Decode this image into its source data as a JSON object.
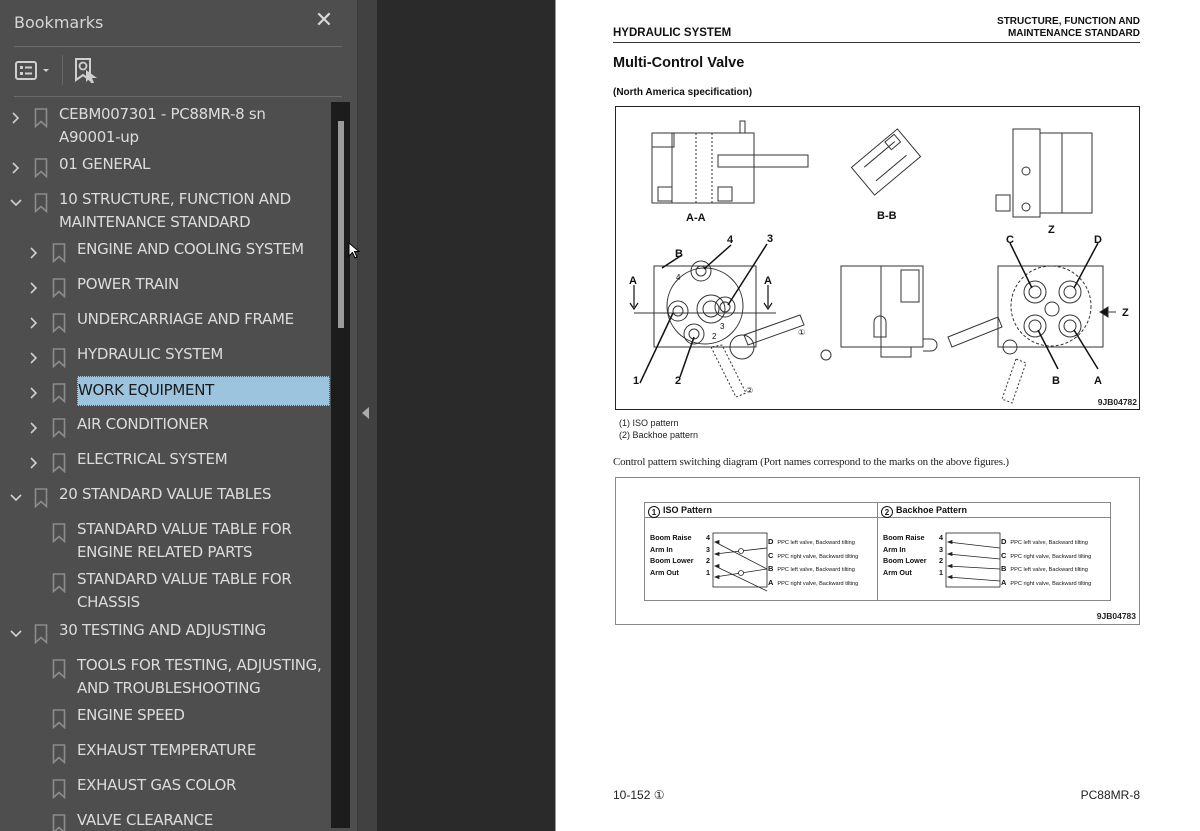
{
  "sidebar": {
    "title": "Bookmarks",
    "close_icon": "close-icon",
    "toolbar": {
      "options_icon": "list-options-icon",
      "find_icon": "find-current-bookmark-icon"
    },
    "items": [
      {
        "label": "CEBM007301 - PC88MR-8 sn\nA90001-up",
        "level": 0,
        "expander": "collapsed"
      },
      {
        "label": "01 GENERAL",
        "level": 0,
        "expander": "collapsed"
      },
      {
        "label": "10 STRUCTURE, FUNCTION AND\nMAINTENANCE STANDARD",
        "level": 0,
        "expander": "expanded"
      },
      {
        "label": "ENGINE AND COOLING SYSTEM",
        "level": 1,
        "expander": "collapsed"
      },
      {
        "label": "POWER TRAIN",
        "level": 1,
        "expander": "collapsed"
      },
      {
        "label": "UNDERCARRIAGE AND FRAME",
        "level": 1,
        "expander": "collapsed"
      },
      {
        "label": "HYDRAULIC SYSTEM",
        "level": 1,
        "expander": "collapsed"
      },
      {
        "label": "WORK EQUIPMENT",
        "level": 1,
        "expander": "collapsed",
        "selected": true
      },
      {
        "label": "AIR CONDITIONER",
        "level": 1,
        "expander": "collapsed"
      },
      {
        "label": "ELECTRICAL SYSTEM",
        "level": 1,
        "expander": "collapsed"
      },
      {
        "label": "20 STANDARD VALUE TABLES",
        "level": 0,
        "expander": "expanded"
      },
      {
        "label": "STANDARD VALUE TABLE FOR\nENGINE RELATED PARTS",
        "level": 1,
        "expander": "none"
      },
      {
        "label": "STANDARD VALUE TABLE FOR\nCHASSIS",
        "level": 1,
        "expander": "none"
      },
      {
        "label": "30 TESTING AND ADJUSTING",
        "level": 0,
        "expander": "expanded"
      },
      {
        "label": "TOOLS FOR TESTING, ADJUSTING,\nAND TROUBLESHOOTING",
        "level": 1,
        "expander": "none"
      },
      {
        "label": "ENGINE SPEED",
        "level": 1,
        "expander": "none"
      },
      {
        "label": "EXHAUST TEMPERATURE",
        "level": 1,
        "expander": "none"
      },
      {
        "label": "EXHAUST GAS COLOR",
        "level": 1,
        "expander": "none"
      },
      {
        "label": "VALVE CLEARANCE",
        "level": 1,
        "expander": "none"
      }
    ],
    "selection_color": "#9cc4de"
  },
  "page": {
    "header_left": "HYDRAULIC SYSTEM",
    "header_right_line1": "STRUCTURE, FUNCTION AND",
    "header_right_line2": "MAINTENANCE STANDARD",
    "title": "Multi-Control Valve",
    "spec": "(North America specification)",
    "figure1": {
      "id": "9JB04782",
      "section_labels": [
        "A-A",
        "B-B",
        "Z"
      ],
      "callouts": [
        "1",
        "2",
        "3",
        "4",
        "A",
        "B",
        "C",
        "D",
        "Z"
      ]
    },
    "legend": [
      "(1) ISO pattern",
      "(2) Backhoe pattern"
    ],
    "caption": "Control pattern switching diagram (Port names correspond to the marks on the above figures.)",
    "figure2": {
      "id": "9JB04783",
      "iso": {
        "num": "1",
        "title": "ISO Pattern",
        "operations": [
          "Boom Raise",
          "Arm In",
          "Boom Lower",
          "Arm Out"
        ],
        "numbers": [
          "4",
          "3",
          "2",
          "1"
        ],
        "ports": [
          {
            "port": "D",
            "desc": "PPC left valve, Backward tilting"
          },
          {
            "port": "C",
            "desc": "PPC right valve, Backward tilting"
          },
          {
            "port": "B",
            "desc": "PPC left valve, Backward tilting"
          },
          {
            "port": "A",
            "desc": "PPC right valve, Backward tilting"
          }
        ]
      },
      "backhoe": {
        "num": "2",
        "title": "Backhoe Pattern",
        "operations": [
          "Boom Raise",
          "Arm In",
          "Boom Lower",
          "Arm Out"
        ],
        "numbers": [
          "4",
          "3",
          "2",
          "1"
        ],
        "ports": [
          {
            "port": "D",
            "desc": "PPC left valve, Backward tilting"
          },
          {
            "port": "C",
            "desc": "PPC right valve, Backward tilting"
          },
          {
            "port": "B",
            "desc": "PPC left valve, Backward tilting"
          },
          {
            "port": "A",
            "desc": "PPC right valve, Backward tilting"
          }
        ]
      }
    },
    "footer_left": "10-152 ①",
    "footer_right": "PC88MR-8"
  }
}
